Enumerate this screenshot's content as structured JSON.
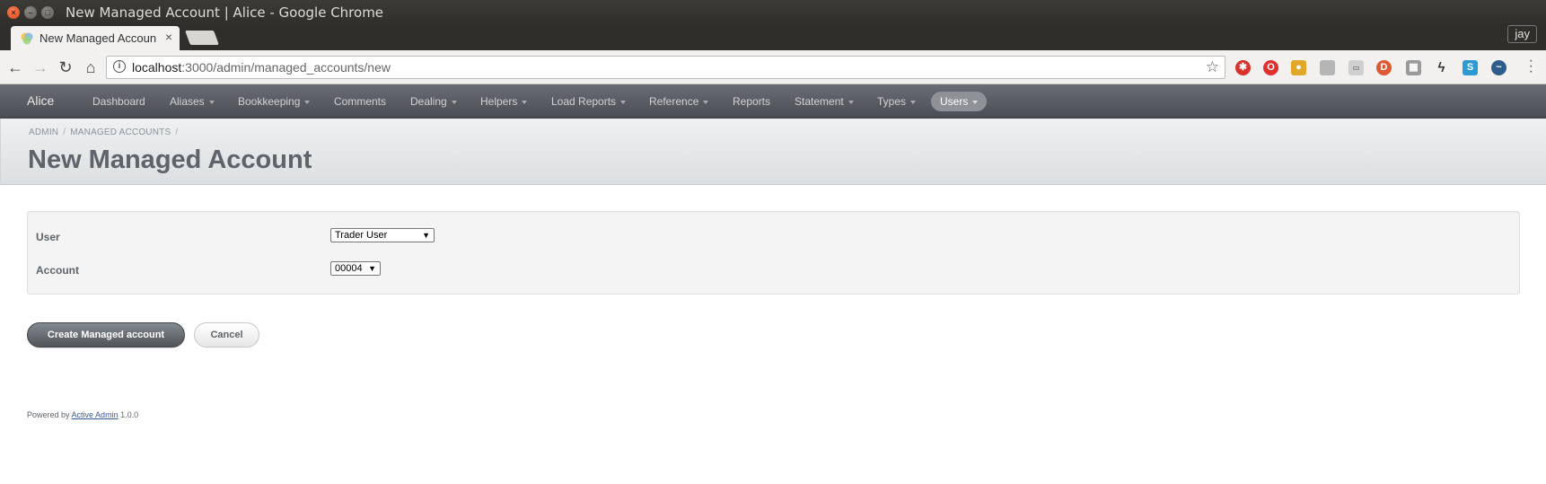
{
  "window": {
    "title": "New Managed Account | Alice - Google Chrome",
    "user": "jay"
  },
  "tab": {
    "title": "New Managed Account",
    "close": "×"
  },
  "address": {
    "host": "localhost",
    "path": ":3000/admin/managed_accounts/new"
  },
  "nav": {
    "site_title": "Alice",
    "items": [
      {
        "label": "Dashboard",
        "dropdown": false
      },
      {
        "label": "Aliases",
        "dropdown": true
      },
      {
        "label": "Bookkeeping",
        "dropdown": true
      },
      {
        "label": "Comments",
        "dropdown": false
      },
      {
        "label": "Dealing",
        "dropdown": true
      },
      {
        "label": "Helpers",
        "dropdown": true
      },
      {
        "label": "Load Reports",
        "dropdown": true
      },
      {
        "label": "Reference",
        "dropdown": true
      },
      {
        "label": "Reports",
        "dropdown": false
      },
      {
        "label": "Statement",
        "dropdown": true
      },
      {
        "label": "Types",
        "dropdown": true
      },
      {
        "label": "Users",
        "dropdown": true,
        "active": true
      }
    ]
  },
  "breadcrumbs": [
    "ADMIN",
    "MANAGED ACCOUNTS"
  ],
  "page_title": "New Managed Account",
  "form": {
    "user_label": "User",
    "user_value": "Trader User",
    "account_label": "Account",
    "account_value": "00004"
  },
  "actions": {
    "submit": "Create Managed account",
    "cancel": "Cancel"
  },
  "footer": {
    "prefix": "Powered by",
    "link": "Active Admin",
    "version": "1.0.0"
  },
  "colors": {
    "header_bg": "#5a5d62",
    "title_text": "#5e6469",
    "link": "#3b5998"
  }
}
